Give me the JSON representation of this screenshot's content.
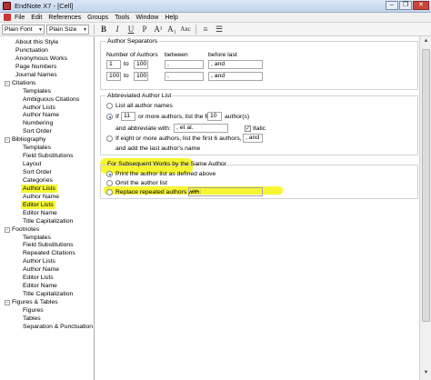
{
  "window": {
    "title": "EndNote X7 - [Cell]",
    "btn_min": "–",
    "btn_max": "❐",
    "btn_close": "✕"
  },
  "menu": [
    "File",
    "Edit",
    "References",
    "Groups",
    "Tools",
    "Window",
    "Help"
  ],
  "toolbar": {
    "font": "Plain Font",
    "size": "Plain Size",
    "bold": "B",
    "italic": "I",
    "underline": "U",
    "plain": "P",
    "super": "A¹",
    "sub": "A₁",
    "smallcaps": "Aʙc"
  },
  "tree": [
    {
      "label": "About this Style",
      "level": 1
    },
    {
      "label": "Punctuation",
      "level": 1
    },
    {
      "label": "Anonymous Works",
      "level": 1
    },
    {
      "label": "Page Numbers",
      "level": 1
    },
    {
      "label": "Journal Names",
      "level": 1
    },
    {
      "label": "Citations",
      "level": 0,
      "toggle": "−"
    },
    {
      "label": "Templates",
      "level": 2
    },
    {
      "label": "Ambiguous Citations",
      "level": 2
    },
    {
      "label": "Author Lists",
      "level": 2
    },
    {
      "label": "Author Name",
      "level": 2
    },
    {
      "label": "Numbering",
      "level": 2
    },
    {
      "label": "Sort Order",
      "level": 2
    },
    {
      "label": "Bibliography",
      "level": 0,
      "toggle": "−"
    },
    {
      "label": "Templates",
      "level": 2
    },
    {
      "label": "Field Substitutions",
      "level": 2
    },
    {
      "label": "Layout",
      "level": 2
    },
    {
      "label": "Sort Order",
      "level": 2
    },
    {
      "label": "Categories",
      "level": 2
    },
    {
      "label": "Author Lists",
      "level": 2,
      "highlight": true
    },
    {
      "label": "Author Name",
      "level": 2
    },
    {
      "label": "Editor Lists",
      "level": 2,
      "highlight": true
    },
    {
      "label": "Editor Name",
      "level": 2
    },
    {
      "label": "Title Capitalization",
      "level": 2
    },
    {
      "label": "Footnotes",
      "level": 0,
      "toggle": "−"
    },
    {
      "label": "Templates",
      "level": 2
    },
    {
      "label": "Field Substitutions",
      "level": 2
    },
    {
      "label": "Repeated Citations",
      "level": 2
    },
    {
      "label": "Author Lists",
      "level": 2
    },
    {
      "label": "Author Name",
      "level": 2
    },
    {
      "label": "Editor Lists",
      "level": 2
    },
    {
      "label": "Editor Name",
      "level": 2
    },
    {
      "label": "Title Capitalization",
      "level": 2
    },
    {
      "label": "Figures & Tables",
      "level": 0,
      "toggle": "−"
    },
    {
      "label": "Figures",
      "level": 2
    },
    {
      "label": "Tables",
      "level": 2
    },
    {
      "label": "Separation & Punctuation",
      "level": 2
    }
  ],
  "separators": {
    "title": "Author Separators",
    "col_authors": "Number of Authors",
    "col_between": "between",
    "col_before_last": "before last",
    "row1": {
      "from": "1",
      "to_label": "to",
      "to": "100",
      "between": ",",
      "before_last": ", and"
    },
    "row2": {
      "from": "100",
      "to_label": "to",
      "to": "100",
      "between": ",",
      "before_last": ", and"
    }
  },
  "abbrev": {
    "title": "Abbreviated Author List",
    "list_all": "List all author names",
    "if_label": "If",
    "if_value": "11",
    "more_text": "or more authors, list the first",
    "first_value": "10",
    "authors_suffix": "author(s)",
    "and_abbrev": "and abbreviate with:",
    "abbrev_value": ", et al.",
    "italic": "Italic",
    "if_eight": "If eight or more authors, list the first 6 authors, insert:",
    "insert_value": ", and",
    "and_add": "and add the last author's name"
  },
  "subsequent": {
    "title": "For Subsequent Works by the Same Author",
    "print_as_defined": "Print the author list as defined above",
    "omit": "Omit the author list",
    "replace": "Replace repeated authors with:",
    "replace_value": "----"
  }
}
